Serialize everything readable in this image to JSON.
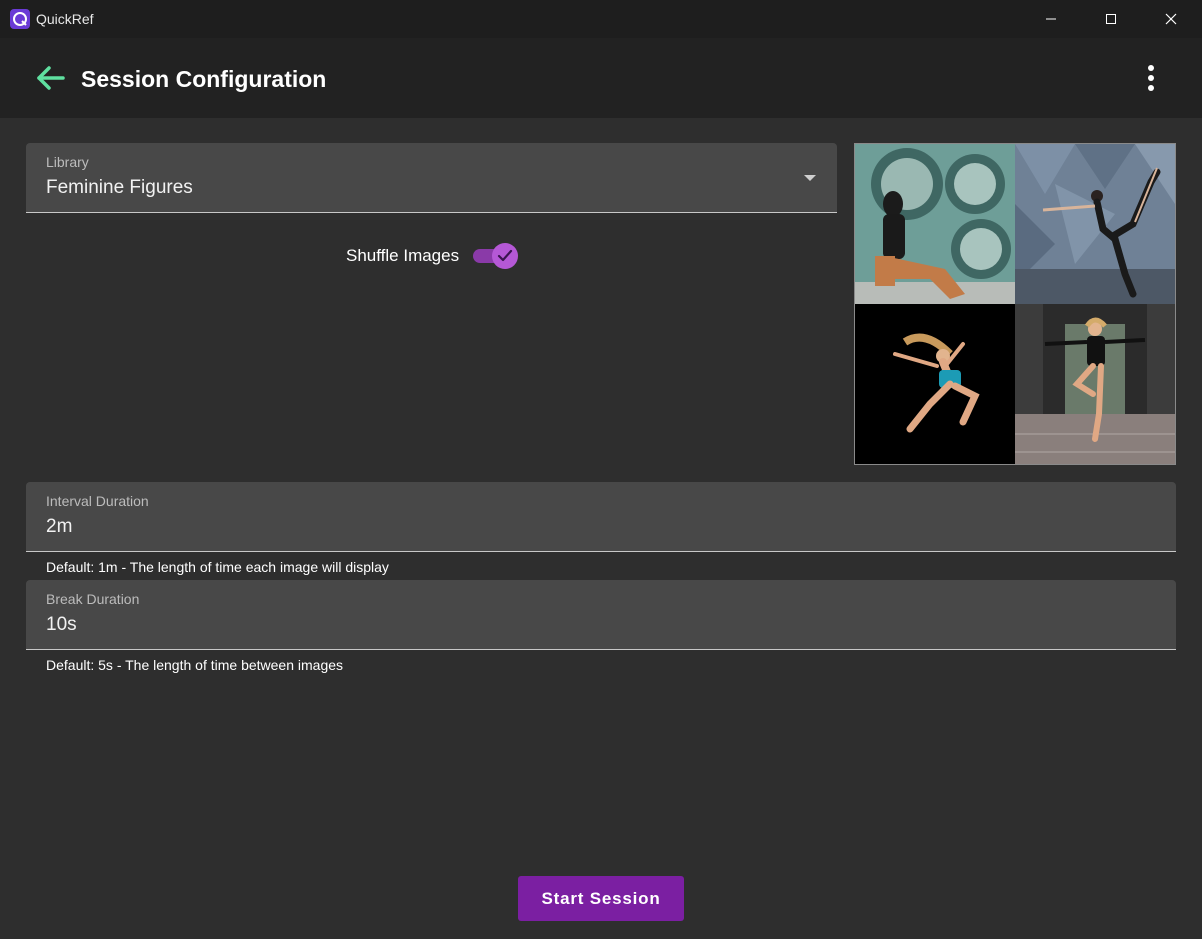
{
  "window": {
    "title": "QuickRef",
    "controls": [
      "minimize-icon",
      "maximize-icon",
      "close-icon"
    ]
  },
  "header": {
    "title": "Session Configuration",
    "back_icon": "arrow-left-icon",
    "menu_icon": "more-vertical-icon"
  },
  "library": {
    "label": "Library",
    "value": "Feminine Figures"
  },
  "shuffle": {
    "label": "Shuffle Images",
    "checked": true
  },
  "preview": {
    "images": [
      "woman-sitting-laundromat",
      "dancer-arabesque-wall",
      "dancer-leaping-black-bg",
      "dancer-jumping-street"
    ]
  },
  "interval": {
    "label": "Interval Duration",
    "value": "2m",
    "helper": "Default: 1m - The length of time each image will display"
  },
  "break": {
    "label": "Break Duration",
    "value": "10s",
    "helper": "Default: 5s - The length of time between images"
  },
  "actions": {
    "start_label": "Start Session"
  },
  "colors": {
    "accent": "#7b1fa2",
    "switch": "#b558d6",
    "back_arrow": "#5fe0a0",
    "background": "#2e2e2e",
    "field": "#484848"
  }
}
